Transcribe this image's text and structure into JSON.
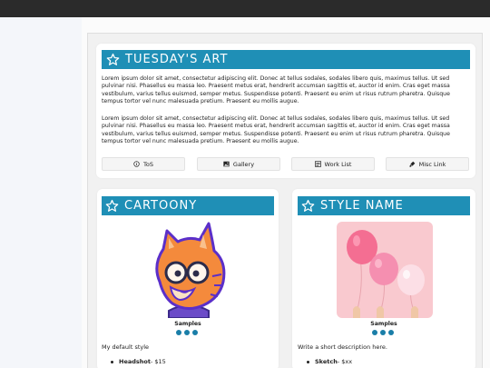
{
  "header": {
    "title": "TUESDAY'S ART",
    "paragraphs": [
      "Lorem ipsum dolor sit amet, consectetur adipiscing elit. Donec at tellus sodales, sodales libero quis, maximus tellus. Ut sed pulvinar nisi. Phasellus eu massa leo. Praesent metus erat, hendrerit accumsan sagittis et, auctor id enim. Cras eget massa vestibulum, varius tellus euismod, semper metus. Suspendisse potenti. Praesent eu enim ut risus rutrum pharetra. Quisque tempus tortor vel nunc malesuada pretium. Praesent eu mollis augue.",
      "Lorem ipsum dolor sit amet, consectetur adipiscing elit. Donec at tellus sodales, sodales libero quis, maximus tellus. Ut sed pulvinar nisi. Phasellus eu massa leo. Praesent metus erat, hendrerit accumsan sagittis et, auctor id enim. Cras eget massa vestibulum, varius tellus euismod, semper metus. Suspendisse potenti. Praesent eu enim ut risus rutrum pharetra. Quisque tempus tortor vel nunc malesuada pretium. Praesent eu mollis augue."
    ],
    "buttons": [
      {
        "label": "ToS",
        "icon": "info-circle-icon"
      },
      {
        "label": "Gallery",
        "icon": "image-icon"
      },
      {
        "label": "Work List",
        "icon": "list-icon"
      },
      {
        "label": "Misc Link",
        "icon": "paint-icon"
      }
    ]
  },
  "styles": [
    {
      "title": "CARTOONY",
      "samples_label": "Samples",
      "description": "My default style",
      "price_item": "Headshot",
      "price_value": " - $15"
    },
    {
      "title": "STYLE NAME",
      "samples_label": "Samples",
      "description": "Write a short description here.",
      "price_item": "Sketch",
      "price_value": " - $xx"
    }
  ],
  "colors": {
    "accent": "#1f8fb6",
    "dot": "#1a7ea8"
  }
}
